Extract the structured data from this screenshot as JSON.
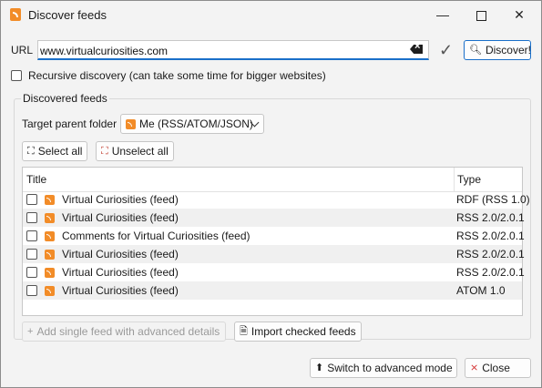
{
  "window": {
    "title": "Discover feeds",
    "minimize": "—",
    "close": "✕"
  },
  "url": {
    "label": "URL",
    "value": "www.virtualcuriosities.com",
    "discover_label": "Discover!"
  },
  "recursive": {
    "label": "Recursive discovery (can take some time for bigger websites)",
    "checked": false
  },
  "discovered": {
    "group_title": "Discovered feeds",
    "target_label": "Target parent folder",
    "target_value": "Me (RSS/ATOM/JSON)",
    "select_all": "Select all",
    "unselect_all": "Unselect all",
    "columns": {
      "title": "Title",
      "type": "Type"
    },
    "rows": [
      {
        "title": "Virtual Curiosities (feed)",
        "type": "RDF (RSS 1.0)"
      },
      {
        "title": "Virtual Curiosities (feed)",
        "type": "RSS 2.0/2.0.1"
      },
      {
        "title": "Comments for Virtual Curiosities (feed)",
        "type": "RSS 2.0/2.0.1"
      },
      {
        "title": "Virtual Curiosities (feed)",
        "type": "RSS 2.0/2.0.1"
      },
      {
        "title": "Virtual Curiosities (feed)",
        "type": "RSS 2.0/2.0.1"
      },
      {
        "title": "Virtual Curiosities (feed)",
        "type": "ATOM 1.0"
      }
    ],
    "add_single": "Add single feed with advanced details",
    "import_checked": "Import checked feeds"
  },
  "footer": {
    "advanced": "Switch to advanced mode",
    "close": "Close"
  },
  "colors": {
    "accent": "#1a6fc9",
    "rss": "#f28c28",
    "close_red": "#d32f2f"
  }
}
